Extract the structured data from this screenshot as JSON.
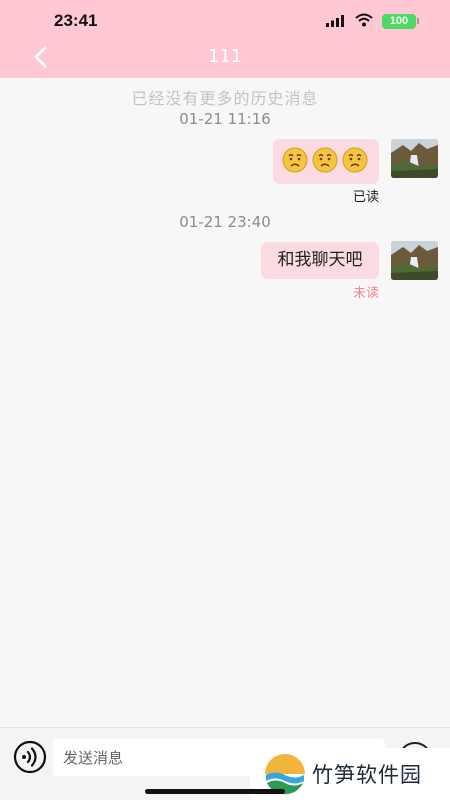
{
  "status_bar": {
    "time": "23:41",
    "battery": "100"
  },
  "header": {
    "title": "111"
  },
  "history_note": "已经没有更多的历史消息",
  "messages": [
    {
      "time": "01-21 11:16",
      "type": "emoji",
      "emoji_icons": [
        "confused-face-icon",
        "confused-face-icon",
        "confused-face-icon"
      ],
      "status": "已读"
    },
    {
      "time": "01-21 23:40",
      "type": "text",
      "text": "和我聊天吧",
      "status": "未读"
    }
  ],
  "colors": {
    "header_bg": "#ffc8d2",
    "bubble_bg": "#fbdbe2",
    "read_status": "#8c8c8c",
    "unread_status": "#f08a8a"
  },
  "input": {
    "placeholder": "发送消息"
  },
  "watermark": {
    "text": "竹笋软件园"
  }
}
